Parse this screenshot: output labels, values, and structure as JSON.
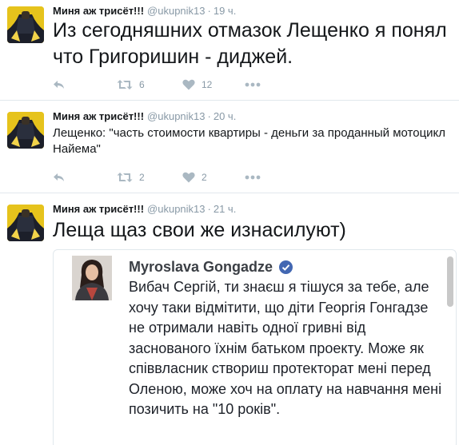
{
  "tweets": [
    {
      "name": "Миня аж трисёт!!!",
      "handle": "@ukupnik13",
      "dot": "·",
      "time": "19 ч.",
      "text": "Из сегодняшних отмазок Лещенко я понял что Григоришин - диджей.",
      "retweets": "6",
      "likes": "12"
    },
    {
      "name": "Миня аж трисёт!!!",
      "handle": "@ukupnik13",
      "dot": "·",
      "time": "20 ч.",
      "text": "Лещенко: \"часть стоимости квартиры - деньги за проданный мотоцикл Найема\"",
      "retweets": "2",
      "likes": "2"
    },
    {
      "name": "Миня аж трисёт!!!",
      "handle": "@ukupnik13",
      "dot": "·",
      "time": "21 ч.",
      "text": "Леща щаз свои же изнасилуют)",
      "embed": {
        "author": "Myroslava Gongadze",
        "text": "Вибач Сергій, ти знаєш я тішуся за тебе, але хочу таки відмітити, що діти Георгія Гонгадзе не отримали навіть одної гривні від заснованого їхнім батьком проекту. Може як співвласник створиш протекторат мені перед Оленою, може хоч на оплату на навчання мені позичить на \"10 років\"."
      }
    }
  ],
  "icons": {
    "reply": "reply-icon",
    "retweet": "retweet-icon",
    "like": "heart-icon",
    "more": "more-icon",
    "verified": "verified-badge-icon"
  },
  "colors": {
    "muted": "#8899a6",
    "icon": "#aab8c2",
    "avatar_bg": "#e8c51a",
    "verified": "#4267b2"
  }
}
